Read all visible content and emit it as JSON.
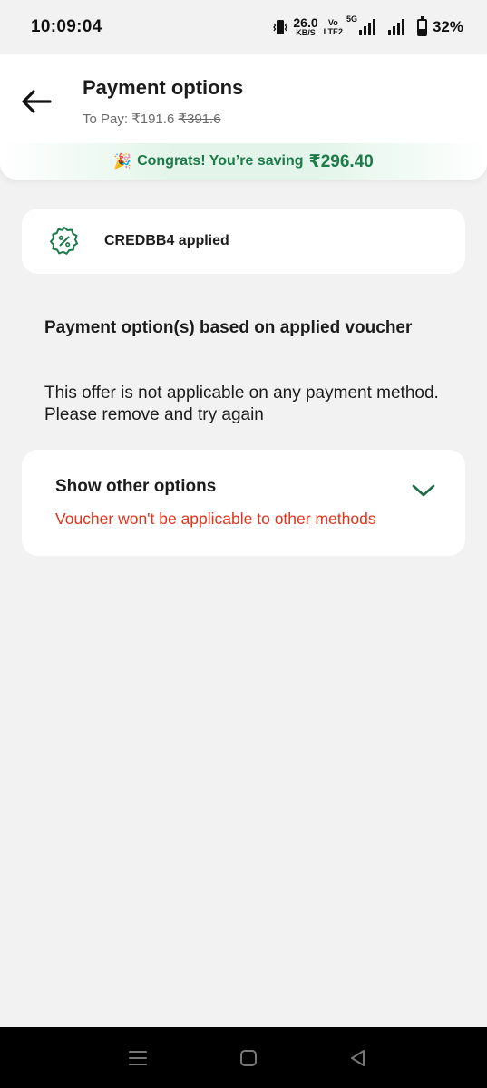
{
  "status_bar": {
    "time": "10:09:04",
    "net_speed_value": "26.0",
    "net_speed_unit": "KB/S",
    "volte_top": "Vo",
    "volte_bottom": "LTE2",
    "network_type": "5G",
    "battery_percent": "32%"
  },
  "header": {
    "back_icon": "arrow-left-icon",
    "title": "Payment options",
    "to_pay_label": "To Pay: ",
    "to_pay_amount": "₹191.6",
    "original_amount": "₹391.6"
  },
  "savings": {
    "emoji": "🎉",
    "text": "Congrats! You’re saving",
    "amount": "₹296.40",
    "color": "#1b7a48"
  },
  "voucher": {
    "icon": "discount-badge-icon",
    "label": "CREDBB4 applied"
  },
  "payment_section": {
    "heading": "Payment option(s) based on applied voucher",
    "info": "This offer is not applicable on any payment method. Please remove and try again"
  },
  "other_options": {
    "title": "Show other options",
    "warning": "Voucher won't be applicable to other methods",
    "chevron_icon": "chevron-down-icon",
    "warning_color": "#e0341b"
  },
  "nav_bar": {
    "items": [
      "menu-icon",
      "home-square-icon",
      "back-triangle-icon"
    ]
  }
}
